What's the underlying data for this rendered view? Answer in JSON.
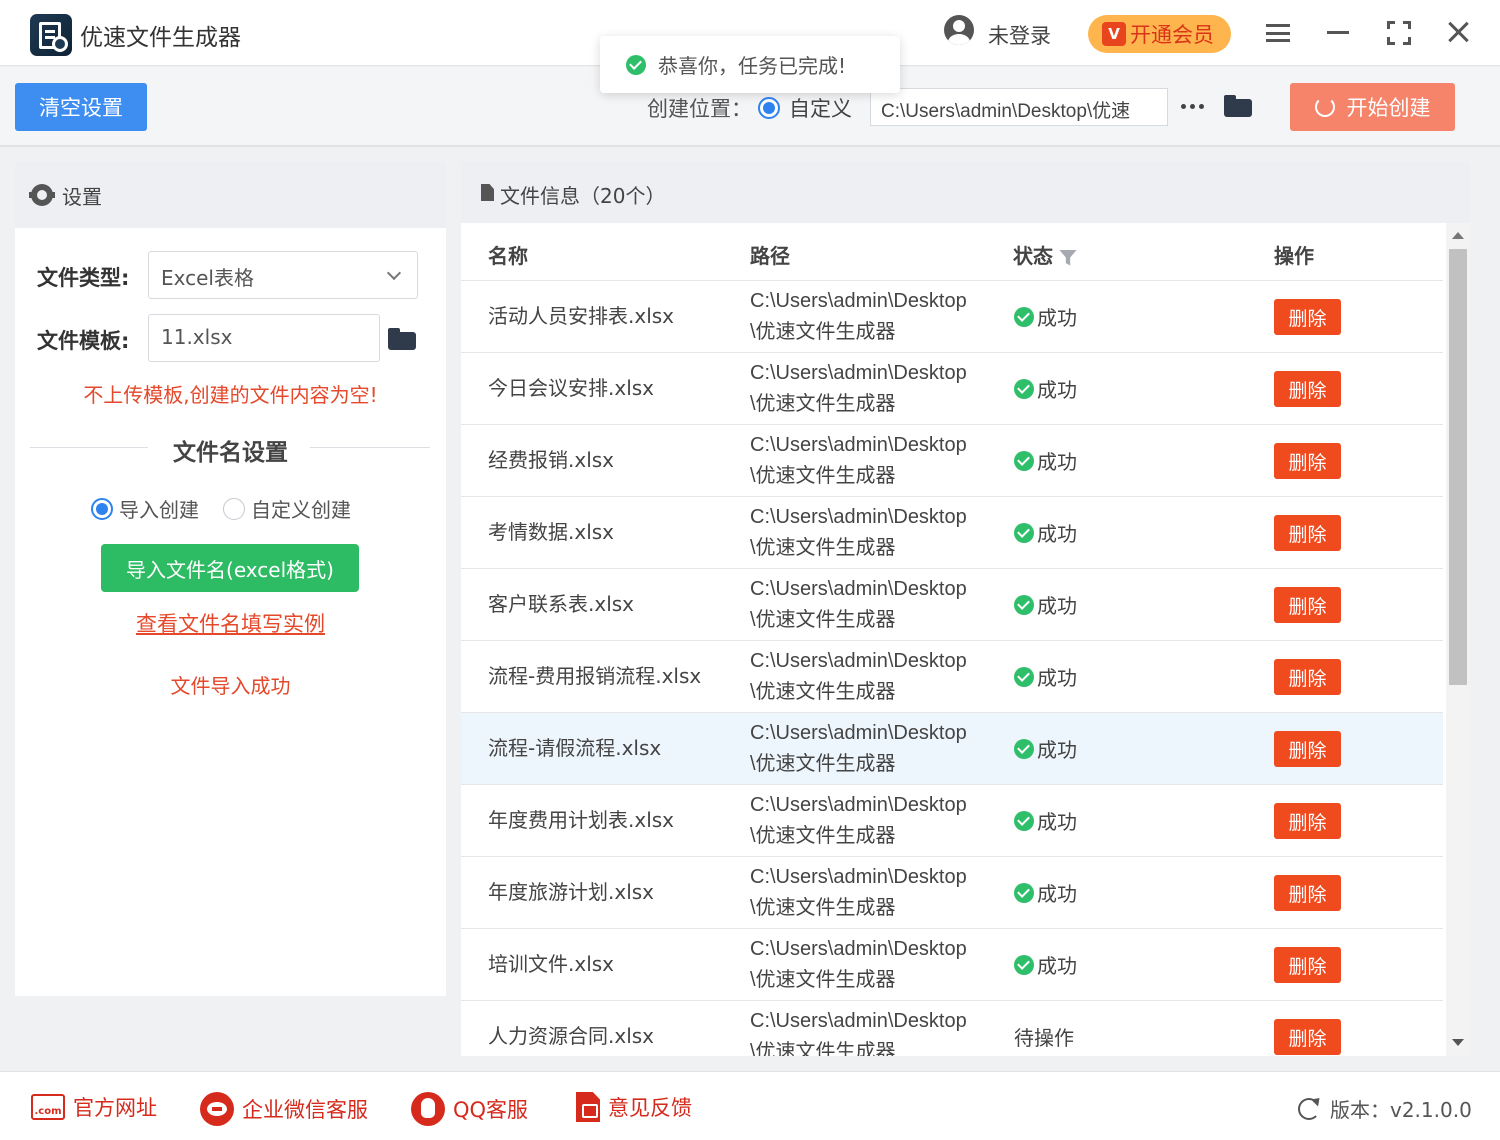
{
  "app": {
    "title": "优速文件生成器"
  },
  "user": {
    "login_text": "未登录",
    "vip_label": "开通会员",
    "vip_icon_text": "V"
  },
  "toast": {
    "message": "恭喜你，任务已完成!"
  },
  "toolbar": {
    "clear_label": "清空设置",
    "location_label": "创建位置：",
    "location_option": "自定义",
    "path_value": "C:\\Users\\admin\\Desktop\\优速",
    "start_label": "开始创建"
  },
  "settings": {
    "header": "设置",
    "file_type_label": "文件类型:",
    "file_type_value": "Excel表格",
    "template_label": "文件模板:",
    "template_value": "11.xlsx",
    "warning": "不上传模板,创建的文件内容为空!",
    "filename_section": "文件名设置",
    "radio_import": "导入创建",
    "radio_custom": "自定义创建",
    "import_button": "导入文件名(excel格式)",
    "example_link": "查看文件名填写实例",
    "import_status": "文件导入成功"
  },
  "file_table": {
    "header": "文件信息（20个）",
    "columns": [
      "名称",
      "路径",
      "状态",
      "操作"
    ],
    "delete_label": "删除",
    "rows": [
      {
        "name": "活动人员安排表.xlsx",
        "path": "C:\\Users\\admin\\Desktop\\优速文件生成器",
        "status": "成功"
      },
      {
        "name": "今日会议安排.xlsx",
        "path": "C:\\Users\\admin\\Desktop\\优速文件生成器",
        "status": "成功"
      },
      {
        "name": "经费报销.xlsx",
        "path": "C:\\Users\\admin\\Desktop\\优速文件生成器",
        "status": "成功"
      },
      {
        "name": "考情数据.xlsx",
        "path": "C:\\Users\\admin\\Desktop\\优速文件生成器",
        "status": "成功"
      },
      {
        "name": "客户联系表.xlsx",
        "path": "C:\\Users\\admin\\Desktop\\优速文件生成器",
        "status": "成功"
      },
      {
        "name": "流程-费用报销流程.xlsx",
        "path": "C:\\Users\\admin\\Desktop\\优速文件生成器",
        "status": "成功"
      },
      {
        "name": "流程-请假流程.xlsx",
        "path": "C:\\Users\\admin\\Desktop\\优速文件生成器",
        "status": "成功"
      },
      {
        "name": "年度费用计划表.xlsx",
        "path": "C:\\Users\\admin\\Desktop\\优速文件生成器",
        "status": "成功"
      },
      {
        "name": "年度旅游计划.xlsx",
        "path": "C:\\Users\\admin\\Desktop\\优速文件生成器",
        "status": "成功"
      },
      {
        "name": "培训文件.xlsx",
        "path": "C:\\Users\\admin\\Desktop\\优速文件生成器",
        "status": "成功"
      },
      {
        "name": "人力资源合同.xlsx",
        "path": "C:\\Users\\admin\\Desktop\\优速文件生成器",
        "status": "待操作"
      }
    ]
  },
  "footer": {
    "website": "官方网址",
    "website_icon_text": ".com",
    "wechat": "企业微信客服",
    "qq": "QQ客服",
    "feedback": "意见反馈",
    "version": "版本：v2.1.0.0"
  },
  "colors": {
    "primary": "#3d8ef0",
    "start_button": "#f5846a",
    "delete_button": "#f04a1f",
    "success_green": "#2fbf6b",
    "import_button": "#2dbb64",
    "warning_red": "#e5482a",
    "vip": "#ffb54d"
  }
}
